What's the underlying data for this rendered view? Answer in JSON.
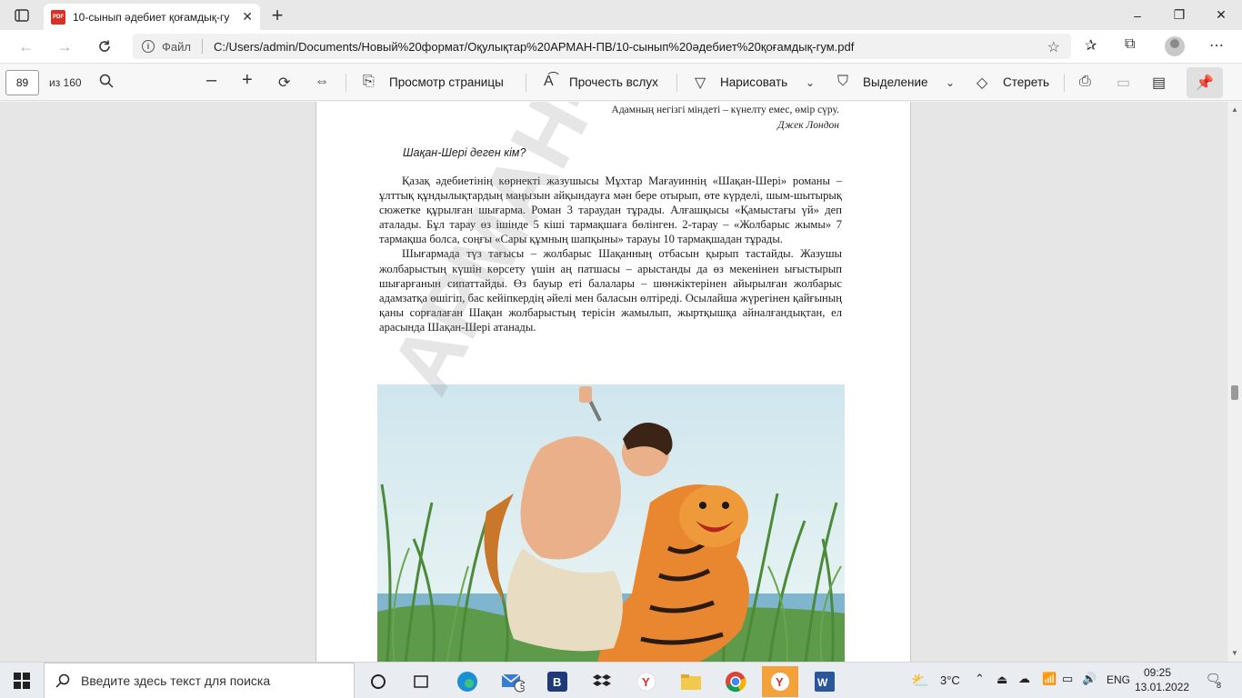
{
  "browser": {
    "tab_title": "10-сынып әдебиет қоғамдық-гу",
    "tab_icon": "pdf-icon",
    "window_controls": {
      "minimize": "–",
      "maximize": "❐",
      "close": "✕"
    }
  },
  "address_bar": {
    "site_label": "Файл",
    "url": "C:/Users/admin/Documents/Новый%20формат/Оқулықтар%20АРМАН-ПВ/10-сынып%20әдебиет%20қоғамдық-гум.pdf"
  },
  "pdf_toolbar": {
    "page_current": "89",
    "page_total": "из 160",
    "view_label": "Просмотр страницы",
    "read_aloud_label": "Прочесть вслух",
    "draw_label": "Нарисовать",
    "highlight_label": "Выделение",
    "erase_label": "Стереть"
  },
  "page": {
    "epigraph_quote": "Адамның негізгі міндеті – күнелту емес, өмір сүру.",
    "epigraph_author": "Джек Лондон",
    "question": "Шақан-Шері деген кім?",
    "paragraph1": "Қазақ әдебиетінің көрнекті жазушысы Мұхтар Мағауиннің «Шақан-Шері» романы – ұлттық құндылықтардың маңызын айқындауға мән бере отырып, өте күрделі, шым-шытырық сюжетке құрылған шығарма. Роман 3 тараудан тұрады. Алғашқысы «Қамыстағы үй» деп аталады. Бұл тарау өз ішінде 5 кіші тармақшаға бөлінген. 2-тарау – «Жолбарыс жымы» 7 тармақша болса, соңғы «Сары құмның шапқыны» тарауы 10 тармақшадан тұрады.",
    "paragraph2": "Шығармада түз тағысы – жолбарыс Шақанның отбасын қырып тастайды. Жазушы жолбарыстың күшін көрсету үшін аң патшасы – арыстанды да өз мекенінен ығыстырып шығарғанын сипаттайды. Өз бауыр еті балалары – шөнжіктерінен айырылған жолбарыс адамзатқа өшігіп, бас кейіпкердің әйелі мен баласын өлтіреді. Осылайша жүрегінен қайғының қаны сорғалаған Шақан жолбарыстың терісін жамылып, жыртқышқа айналғандықтан, ел арасында Шақан-Шері атанады.",
    "watermark": "АРМАН-ПВ"
  },
  "taskbar": {
    "search_placeholder": "Введите здесь текст для поиска",
    "weather": "3°C",
    "language": "ENG",
    "time": "09:25",
    "date": "13.01.2022",
    "mail_badge": "5",
    "notification_count": "8"
  },
  "colors": {
    "tab_strip": "#e8e8e8",
    "taskbar": "#e9edf2",
    "active_app": "#f3a23b",
    "pdf_red": "#d93025"
  }
}
